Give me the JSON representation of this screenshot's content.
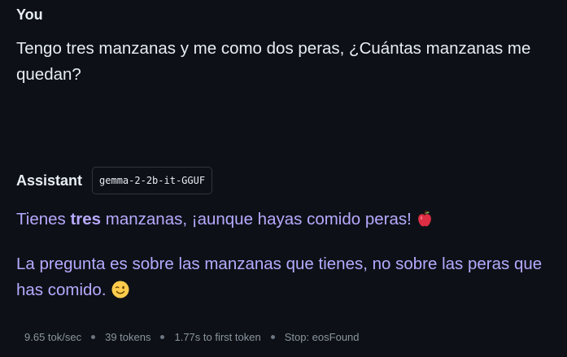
{
  "user": {
    "label": "You",
    "message": "Tengo tres manzanas y me como dos peras, ¿Cuántas manzanas me quedan?"
  },
  "assistant": {
    "label": "Assistant",
    "model": "gemma-2-2b-it-GGUF",
    "paragraph1": {
      "before": "Tienes ",
      "bold": "tres",
      "after": " manzanas, ¡aunque hayas comido peras!",
      "emoji": "red-apple-icon"
    },
    "paragraph2": {
      "text": "La pregunta es sobre las manzanas que tienes, no sobre las peras que has comido.",
      "emoji": "winking-face-icon"
    }
  },
  "stats": {
    "speed": "9.65 tok/sec",
    "tokens": "39 tokens",
    "first_token": "1.77s to first token",
    "stop": "Stop: eosFound"
  },
  "colors": {
    "background": "#0d1117",
    "user_text": "#e6edf3",
    "assistant_text": "#b7a9ff",
    "stats_text": "#8b949e"
  }
}
